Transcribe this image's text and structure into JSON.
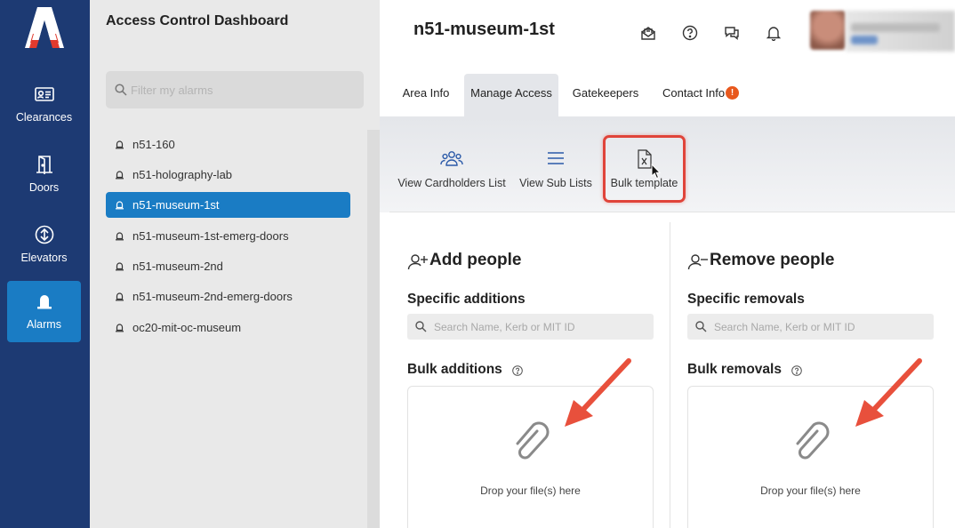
{
  "app": {
    "logo": "A",
    "panel_title": "Access Control Dashboard"
  },
  "nav": [
    {
      "label": "Clearances",
      "icon": "id-card-icon",
      "active": false
    },
    {
      "label": "Doors",
      "icon": "door-icon",
      "active": false
    },
    {
      "label": "Elevators",
      "icon": "elevator-icon",
      "active": false
    },
    {
      "label": "Alarms",
      "icon": "alarm-icon",
      "active": true
    }
  ],
  "filter": {
    "placeholder": "Filter my alarms"
  },
  "alarms": [
    {
      "name": "n51-160",
      "active": false
    },
    {
      "name": "n51-holography-lab",
      "active": false
    },
    {
      "name": "n51-museum-1st",
      "active": true
    },
    {
      "name": "n51-museum-1st-emerg-doors",
      "active": false
    },
    {
      "name": "n51-museum-2nd",
      "active": false
    },
    {
      "name": "n51-museum-2nd-emerg-doors",
      "active": false
    },
    {
      "name": "oc20-mit-oc-museum",
      "active": false
    }
  ],
  "header": {
    "title": "n51-museum-1st",
    "icons": [
      "mail-icon",
      "help-icon",
      "chat-icon",
      "bell-icon"
    ]
  },
  "tabs": [
    {
      "label": "Area Info",
      "active": false
    },
    {
      "label": "Manage Access",
      "active": true
    },
    {
      "label": "Gatekeepers",
      "active": false
    },
    {
      "label": "Contact Info",
      "active": false,
      "badge": "!"
    }
  ],
  "toolbar": [
    {
      "label": "View Cardholders List",
      "icon": "people-group-icon"
    },
    {
      "label": "View Sub Lists",
      "icon": "list-icon"
    },
    {
      "label": "Bulk template",
      "icon": "excel-file-icon",
      "highlighted": true
    }
  ],
  "add": {
    "title": "Add people",
    "specific": "Specific additions",
    "search_placeholder": "Search Name, Kerb or MIT ID",
    "bulk": "Bulk additions",
    "drop_text": "Drop your file(s) here"
  },
  "remove": {
    "title": "Remove people",
    "specific": "Specific removals",
    "search_placeholder": "Search Name, Kerb or MIT ID",
    "bulk": "Bulk removals",
    "drop_text": "Drop your file(s) here"
  },
  "colors": {
    "rail": "#1d3a73",
    "accent": "#1a7cc4",
    "warning": "#e8581d",
    "annotation": "#e0443a"
  }
}
